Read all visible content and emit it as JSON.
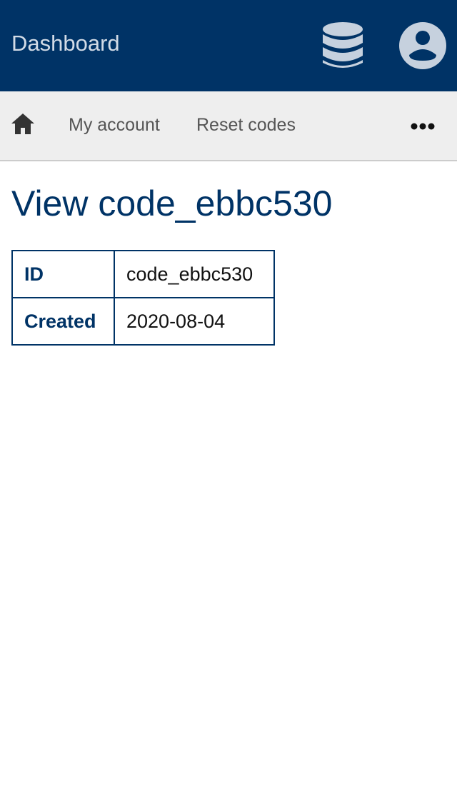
{
  "header": {
    "title": "Dashboard",
    "icons": {
      "database": "database-icon",
      "account": "user-circle-icon"
    }
  },
  "nav": {
    "home_icon": "home-icon",
    "items": [
      {
        "label": "My account"
      },
      {
        "label": "Reset codes"
      }
    ],
    "more_icon": "more-horizontal-icon"
  },
  "page": {
    "title": "View code_ebbc530"
  },
  "details": {
    "rows": [
      {
        "key": "ID",
        "value": "code_ebbc530"
      },
      {
        "key": "Created",
        "value": "2020-08-04"
      }
    ]
  },
  "colors": {
    "header_bg": "#003366",
    "header_fg": "#d2dbe6",
    "nav_bg": "#eeeeee",
    "accent": "#003366"
  }
}
